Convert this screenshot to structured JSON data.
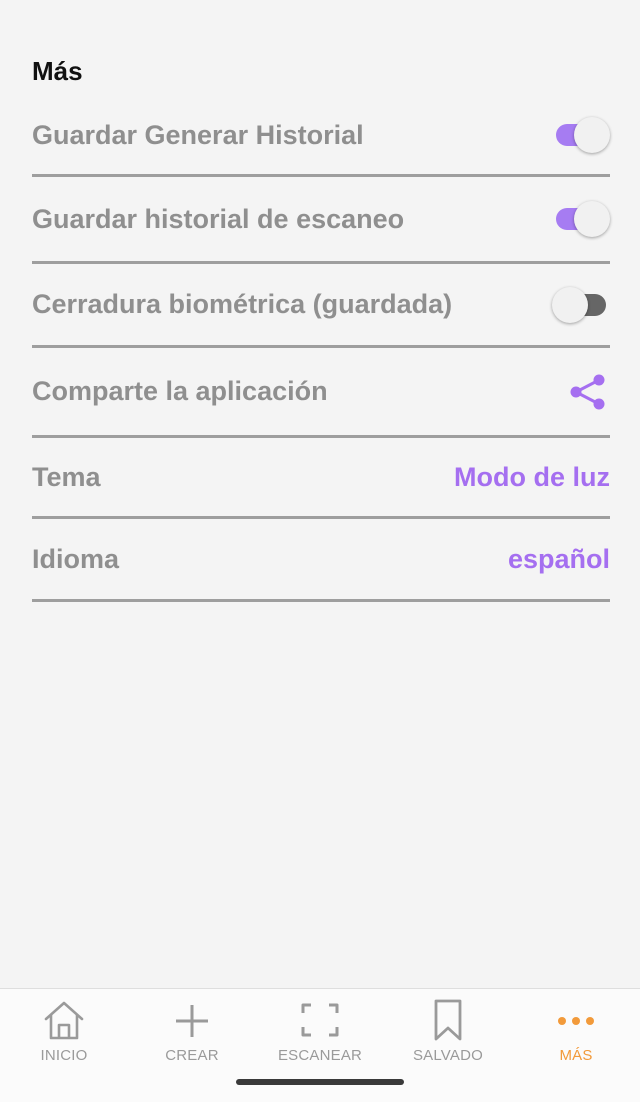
{
  "page": {
    "title": "Más"
  },
  "settings": {
    "items": [
      {
        "label": "Guardar Generar Historial",
        "control": "toggle",
        "on": true
      },
      {
        "label": "Guardar historial de escaneo",
        "control": "toggle",
        "on": true
      },
      {
        "label": "Cerradura biométrica (guardada)",
        "control": "toggle",
        "on": false
      },
      {
        "label": "Comparte la aplicación",
        "control": "share",
        "icon": "share-icon"
      },
      {
        "label": "Tema",
        "value": "Modo de luz"
      },
      {
        "label": "Idioma",
        "value": "español"
      }
    ]
  },
  "nav": {
    "items": [
      {
        "label": "INICIO",
        "icon": "home-icon"
      },
      {
        "label": "CREAR",
        "icon": "plus-icon"
      },
      {
        "label": "ESCANEAR",
        "icon": "scan-icon"
      },
      {
        "label": "SALVADO",
        "icon": "bookmark-icon"
      },
      {
        "label": "MÁS",
        "icon": "more-icon",
        "active": true
      }
    ]
  },
  "colors": {
    "accent": "#a56ff0",
    "toggle_on": "#a67cf2",
    "active_nav": "#f29a3a",
    "muted_text": "#8f8f8f",
    "background": "#f4f4f4"
  }
}
